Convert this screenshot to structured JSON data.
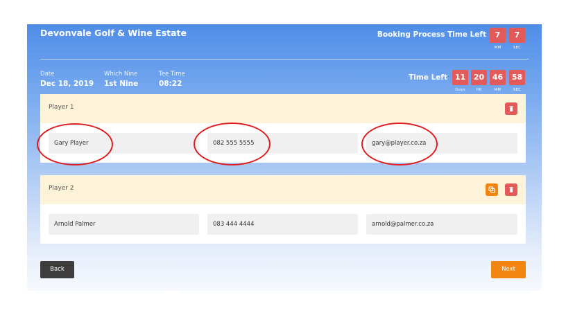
{
  "header": {
    "title": "Devonvale Golf & Wine Estate",
    "booking_timer": {
      "label": "Booking Process Time Left",
      "minutes": "7",
      "minutes_unit": "MM",
      "seconds": "7",
      "seconds_unit": "SEC"
    }
  },
  "booking": {
    "date_label": "Date",
    "date": "Dec 18, 2019",
    "nine_label": "Which Nine",
    "nine": "1st Nine",
    "tee_label": "Tee Time",
    "tee_time": "08:22"
  },
  "tee_timer": {
    "label": "Time Left",
    "days": "11",
    "days_unit": "Days",
    "hours": "20",
    "hours_unit": "HR",
    "minutes": "46",
    "minutes_unit": "MM",
    "seconds": "58",
    "seconds_unit": "SEC"
  },
  "players": [
    {
      "title": "Player 1",
      "name": "Gary Player",
      "phone": "082 555 5555",
      "email": "gary@player.co.za"
    },
    {
      "title": "Player 2",
      "name": "Arnold Palmer",
      "phone": "083 444 4444",
      "email": "arnold@palmer.co.za"
    }
  ],
  "actions": {
    "back": "Back",
    "next": "Next"
  },
  "colors": {
    "header_blue": "#4f8ee8",
    "timer_red": "#e35a5a",
    "card_header": "#fdf3d9",
    "back_button": "#3d3d3d",
    "next_button": "#f28410",
    "copy_button": "#f28410",
    "delete_button": "#e35a5a",
    "annotation_red": "#e01b1b"
  },
  "icons": {
    "delete": "trash-icon",
    "copy": "copy-icon"
  }
}
